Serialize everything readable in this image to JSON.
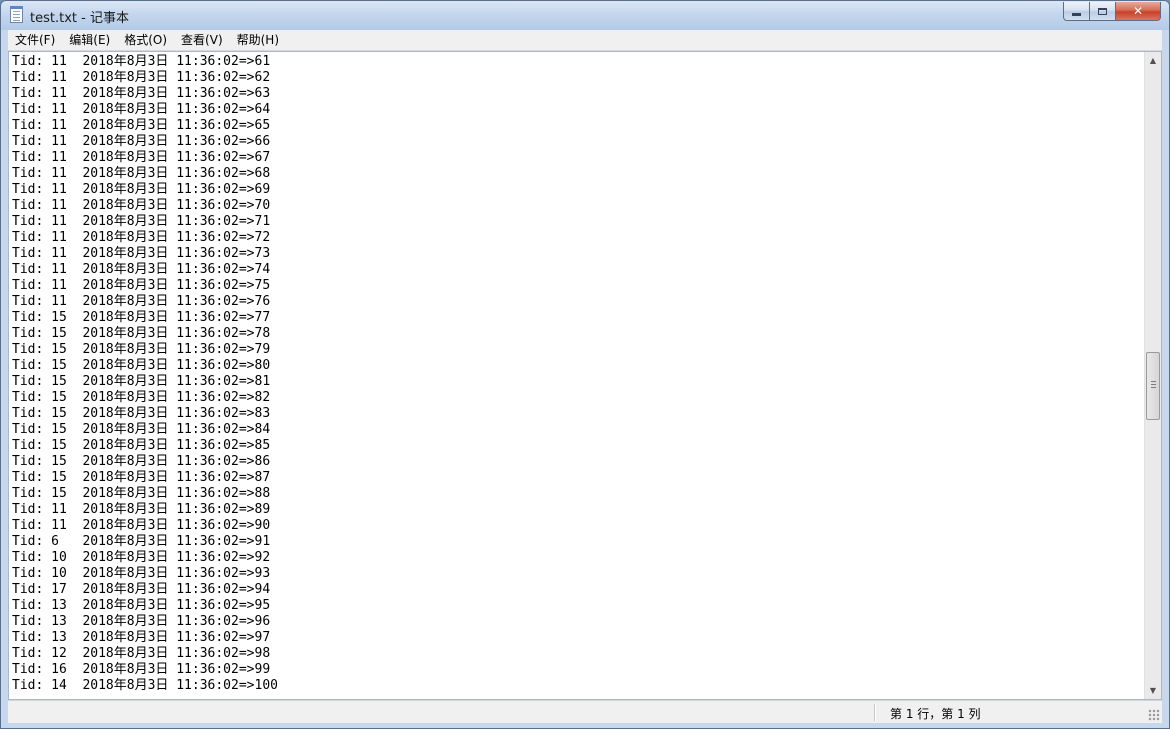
{
  "window": {
    "title": "test.txt - 记事本"
  },
  "menu": [
    {
      "label": "文件(F)"
    },
    {
      "label": "编辑(E)"
    },
    {
      "label": "格式(O)"
    },
    {
      "label": "查看(V)"
    },
    {
      "label": "帮助(H)"
    }
  ],
  "editor": {
    "lines": [
      "Tid: 11  2018年8月3日 11:36:02=>61",
      "Tid: 11  2018年8月3日 11:36:02=>62",
      "Tid: 11  2018年8月3日 11:36:02=>63",
      "Tid: 11  2018年8月3日 11:36:02=>64",
      "Tid: 11  2018年8月3日 11:36:02=>65",
      "Tid: 11  2018年8月3日 11:36:02=>66",
      "Tid: 11  2018年8月3日 11:36:02=>67",
      "Tid: 11  2018年8月3日 11:36:02=>68",
      "Tid: 11  2018年8月3日 11:36:02=>69",
      "Tid: 11  2018年8月3日 11:36:02=>70",
      "Tid: 11  2018年8月3日 11:36:02=>71",
      "Tid: 11  2018年8月3日 11:36:02=>72",
      "Tid: 11  2018年8月3日 11:36:02=>73",
      "Tid: 11  2018年8月3日 11:36:02=>74",
      "Tid: 11  2018年8月3日 11:36:02=>75",
      "Tid: 11  2018年8月3日 11:36:02=>76",
      "Tid: 15  2018年8月3日 11:36:02=>77",
      "Tid: 15  2018年8月3日 11:36:02=>78",
      "Tid: 15  2018年8月3日 11:36:02=>79",
      "Tid: 15  2018年8月3日 11:36:02=>80",
      "Tid: 15  2018年8月3日 11:36:02=>81",
      "Tid: 15  2018年8月3日 11:36:02=>82",
      "Tid: 15  2018年8月3日 11:36:02=>83",
      "Tid: 15  2018年8月3日 11:36:02=>84",
      "Tid: 15  2018年8月3日 11:36:02=>85",
      "Tid: 15  2018年8月3日 11:36:02=>86",
      "Tid: 15  2018年8月3日 11:36:02=>87",
      "Tid: 15  2018年8月3日 11:36:02=>88",
      "Tid: 11  2018年8月3日 11:36:02=>89",
      "Tid: 11  2018年8月3日 11:36:02=>90",
      "Tid: 6   2018年8月3日 11:36:02=>91",
      "Tid: 10  2018年8月3日 11:36:02=>92",
      "Tid: 10  2018年8月3日 11:36:02=>93",
      "Tid: 17  2018年8月3日 11:36:02=>94",
      "Tid: 13  2018年8月3日 11:36:02=>95",
      "Tid: 13  2018年8月3日 11:36:02=>96",
      "Tid: 13  2018年8月3日 11:36:02=>97",
      "Tid: 12  2018年8月3日 11:36:02=>98",
      "Tid: 16  2018年8月3日 11:36:02=>99",
      "Tid: 14  2018年8月3日 11:36:02=>100"
    ]
  },
  "status": {
    "position": "第 1 行，第 1 列"
  },
  "icons": {
    "app": "notepad-icon",
    "minimize": "minimize-icon",
    "maximize": "maximize-icon",
    "close": "close-icon"
  }
}
